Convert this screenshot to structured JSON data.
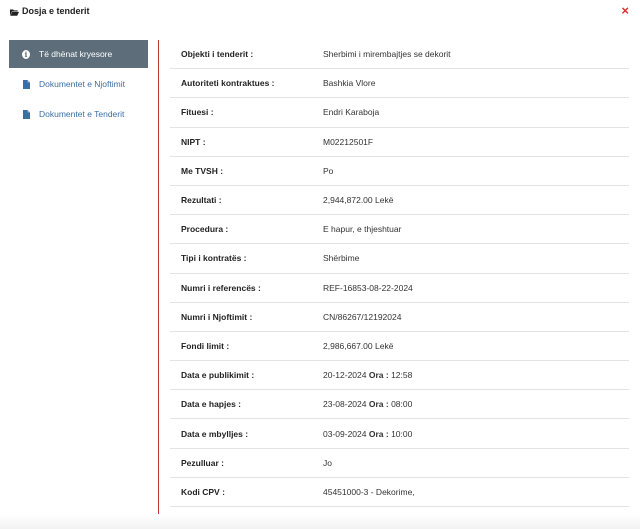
{
  "header": {
    "title": "Dosja e tenderit",
    "folder_icon": "folder-open-icon",
    "close_icon": "close-icon",
    "close_glyph": "×",
    "close_color": "#d9302c"
  },
  "sidebar": {
    "items": [
      {
        "label": "Të dhënat kryesore",
        "icon": "info-circle-icon",
        "active": true
      },
      {
        "label": "Dokumentet e Njoftimit",
        "icon": "file-icon",
        "active": false
      },
      {
        "label": "Dokumentet e Tenderit",
        "icon": "file-icon",
        "active": false
      }
    ],
    "active_bg": "#5d6e7a",
    "link_color": "#3b6ea5"
  },
  "details": {
    "rows": [
      {
        "label": "Objekti i tenderit :",
        "value": "Sherbimi i mirembajtjes se dekorit"
      },
      {
        "label": "Autoriteti kontraktues :",
        "value": "Bashkia Vlore"
      },
      {
        "label": "Fituesi :",
        "value": "Endri Karaboja"
      },
      {
        "label": "NIPT :",
        "value": "M02212501F"
      },
      {
        "label": "Me TVSH :",
        "value": "Po"
      },
      {
        "label": "Rezultati :",
        "value": "2,944,872.00 Lekë"
      },
      {
        "label": "Procedura :",
        "value": "E hapur, e thjeshtuar"
      },
      {
        "label": "Tipi i kontratës :",
        "value": "Shërbime"
      },
      {
        "label": "Numri i referencës :",
        "value": "REF-16853-08-22-2024"
      },
      {
        "label": "Numri i Njoftimit :",
        "value": "CN/86267/12192024"
      },
      {
        "label": "Fondi limit :",
        "value": "2,986,667.00 Lekë"
      },
      {
        "label": "Data e publikimit :",
        "date": "20-12-2024",
        "time_label": "Ora :",
        "time": "12:58"
      },
      {
        "label": "Data e hapjes :",
        "date": "23-08-2024",
        "time_label": "Ora :",
        "time": "08:00"
      },
      {
        "label": "Data e mbylljes :",
        "date": "03-09-2024",
        "time_label": "Ora :",
        "time": "10:00"
      },
      {
        "label": "Pezulluar :",
        "value": "Jo"
      },
      {
        "label": "Kodi CPV :",
        "value": "45451000-3 - Dekorime,"
      }
    ]
  }
}
